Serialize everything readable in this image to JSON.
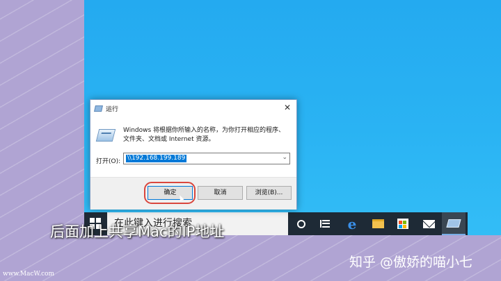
{
  "dialog": {
    "title": "运行",
    "close_glyph": "✕",
    "description": "Windows 将根据你所输入的名称，为你打开相应的程序、文件夹、文档或 Internet 资源。",
    "open_label": "打开(O):",
    "open_value": "\\\\192.168.199.189",
    "dropdown_glyph": "⌄",
    "buttons": {
      "ok": "确定",
      "cancel": "取消",
      "browse": "浏览(B)..."
    }
  },
  "taskbar": {
    "search_placeholder": "在此键入进行搜索",
    "icons": [
      "windows-start-icon",
      "cortana-icon",
      "task-view-icon",
      "edge-icon",
      "file-explorer-icon",
      "store-icon",
      "mail-icon",
      "run-icon"
    ]
  },
  "overlay": {
    "subtitle": "后面加上共享Mac的IP地址",
    "watermark_zhihu": "知乎 @傲娇的喵小七",
    "watermark_macw": "www.MacW.com"
  },
  "colors": {
    "desktop": "#2ab3f3",
    "taskbar": "#1e2a36",
    "highlight": "#d9463d",
    "selection": "#0078d7"
  }
}
